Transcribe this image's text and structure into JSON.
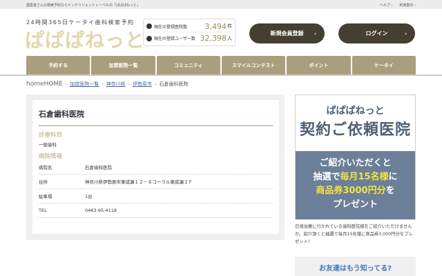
{
  "topbar": {
    "intro": "歯医者さんの検索予約ならインテリジェントレーベルの「ぱぱぱねっと」",
    "help": "ヘルプ ›",
    "guide": "利用案内 ›"
  },
  "header": {
    "tagline": "24時間365日ケータイ歯科検索予約",
    "logo": "ぱぱぱねっと",
    "stats": [
      {
        "label": "現在の登録医院数",
        "value": "3,494",
        "unit": "件"
      },
      {
        "label": "現在の登録ユーザー数",
        "value": "32,398",
        "unit": "人"
      }
    ],
    "register": "新規会員登録",
    "login": "ログイン",
    "chevron": "›"
  },
  "nav": [
    "予約する",
    "加盟医院一覧",
    "コミュニティ",
    "スマイルコンテスト",
    "ポイント",
    "ケータイ"
  ],
  "breadcrumb": {
    "home": "homeHOME",
    "items": [
      "加盟医院一覧",
      "神奈川県",
      "伊勢原市"
    ],
    "current": "石倉歯科医院",
    "sep": "›"
  },
  "clinic": {
    "name": "石倉歯科医院",
    "dept_heading": "診療科目",
    "dept": "一般歯科",
    "info_heading": "病院情報",
    "rows": [
      {
        "k": "病院名",
        "v": "石倉歯科医院"
      },
      {
        "k": "住所",
        "v": "神奈川県伊勢原市東成瀬１２－６コーラル東成瀬２Ｆ"
      },
      {
        "k": "駐車場",
        "v": "1台"
      },
      {
        "k": "TEL",
        "v": "0463-95-4118"
      }
    ]
  },
  "banner": {
    "logo": "ぱぱぱねっと",
    "title": "契約ご依頼医院",
    "l1": "ご紹介いただくと",
    "l2a": "抽選で",
    "l2b": "毎月15名様",
    "l2c": "に",
    "l3a": "商品券3000円分",
    "l3b": "を",
    "l4": "プレゼント",
    "text": "日頃治療に行かれている歯科医院様をご紹介いただけませんか。紹介頂くと抽選で毎月15名様に商品券3,000円分をプレゼント！"
  },
  "friend": "お友達はもう知ってる?"
}
